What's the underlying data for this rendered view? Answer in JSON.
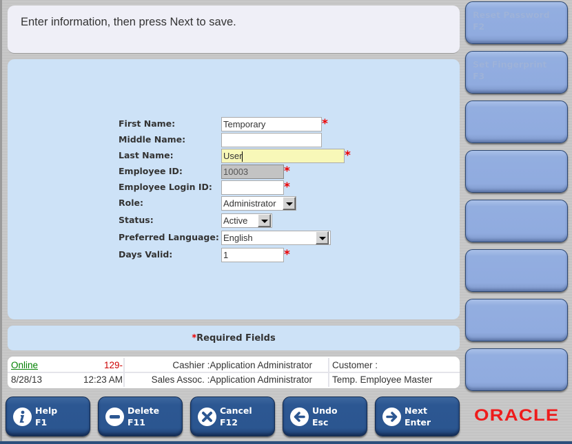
{
  "prompt": {
    "text": "Enter information, then press Next to save."
  },
  "form": {
    "fields": [
      {
        "label": "First Name:",
        "value": "Temporary",
        "required": true,
        "type": "text"
      },
      {
        "label": "Middle Name:",
        "value": "",
        "required": false,
        "type": "text"
      },
      {
        "label": "Last Name:",
        "value": "User",
        "required": true,
        "type": "text",
        "focused": true
      },
      {
        "label": "Employee ID:",
        "value": "10003",
        "required": true,
        "type": "text",
        "disabled": true
      },
      {
        "label": "Employee Login ID:",
        "value": "",
        "required": true,
        "type": "text"
      },
      {
        "label": "Role:",
        "value": "Administrator",
        "required": false,
        "type": "select"
      },
      {
        "label": "Status:",
        "value": "Active",
        "required": false,
        "type": "select"
      },
      {
        "label": "Preferred Language:",
        "value": "English",
        "required": false,
        "type": "select"
      },
      {
        "label": "Days Valid:",
        "value": "1",
        "required": true,
        "type": "text"
      }
    ],
    "required_marker": "*",
    "required_note": "Required Fields"
  },
  "status_bar": {
    "connection": "Online",
    "register": "129-",
    "cashier": "Cashier :Application Administrator",
    "customer": "Customer :",
    "date": "8/28/13",
    "time": "12:23 AM",
    "sales_assoc": "Sales Assoc. :Application Administrator",
    "screen": "Temp. Employee Master",
    "colors": {
      "online": "#008000",
      "register": "#cc0000"
    }
  },
  "side_buttons": [
    {
      "label": "Reset Password",
      "key": "F2",
      "enabled": false
    },
    {
      "label": "Set Fingerprint",
      "key": "F3",
      "enabled": false
    },
    {
      "label": "",
      "key": ""
    },
    {
      "label": "",
      "key": ""
    },
    {
      "label": "",
      "key": ""
    },
    {
      "label": "",
      "key": ""
    },
    {
      "label": "",
      "key": ""
    },
    {
      "label": "",
      "key": ""
    }
  ],
  "bottom_buttons": [
    {
      "label": "Help",
      "key": "F1",
      "icon": "info-icon"
    },
    {
      "label": "Delete",
      "key": "F11",
      "icon": "minus-icon"
    },
    {
      "label": "Cancel",
      "key": "F12",
      "icon": "x-icon"
    },
    {
      "label": "Undo",
      "key": "Esc",
      "icon": "arrow-left-icon"
    },
    {
      "label": "Next",
      "key": "Enter",
      "icon": "arrow-right-icon"
    }
  ],
  "brand": {
    "logo_text": "ORACLE",
    "color": "#ee1b1b"
  }
}
